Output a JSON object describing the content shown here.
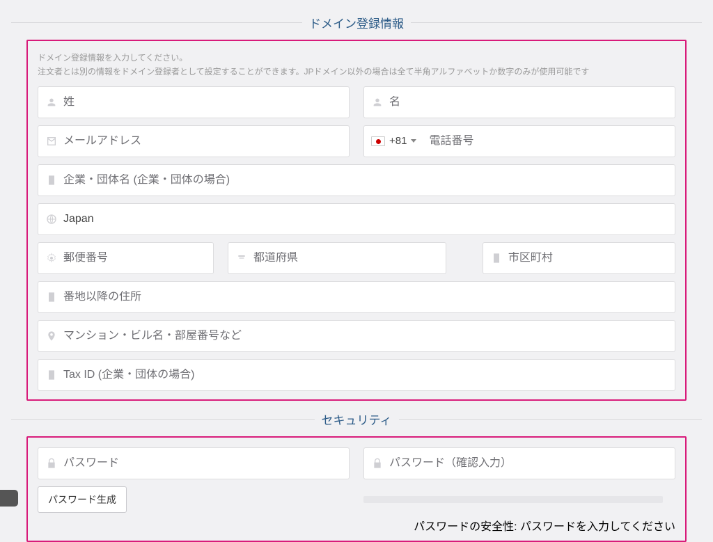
{
  "domain_section": {
    "title": "ドメイン登録情報",
    "desc_line1": "ドメイン登録情報を入力してください。",
    "desc_line2": "注文者とは別の情報をドメイン登録者として設定することができます。JPドメイン以外の場合は全て半角アルファベットか数字のみが使用可能です",
    "lastname_ph": "姓",
    "firstname_ph": "名",
    "email_ph": "メールアドレス",
    "phone_code": "+81",
    "phone_ph": "電話番号",
    "company_ph": "企業・団体名 (企業・団体の場合)",
    "country_value": "Japan",
    "postal_ph": "郵便番号",
    "prefecture_ph": "都道府県",
    "city_ph": "市区町村",
    "address_ph": "番地以降の住所",
    "building_ph": "マンション・ビル名・部屋番号など",
    "taxid_ph": "Tax ID (企業・団体の場合)"
  },
  "security_section": {
    "title": "セキュリティ",
    "password_ph": "パスワード",
    "password_confirm_ph": "パスワード（確認入力）",
    "generate_btn": "パスワード生成",
    "strength_label": "パスワードの安全性: パスワードを入力してください"
  }
}
